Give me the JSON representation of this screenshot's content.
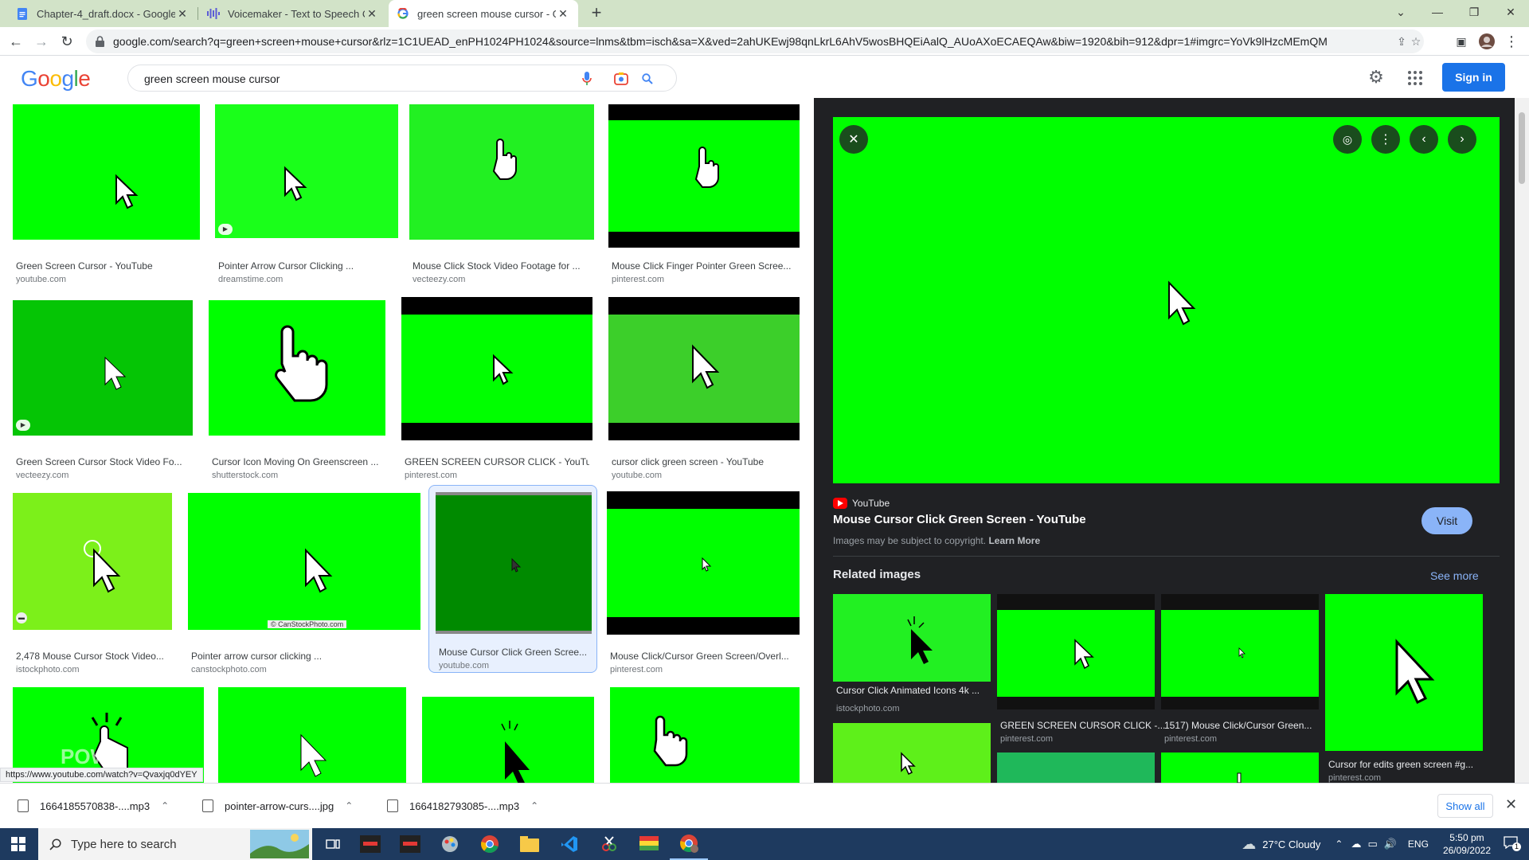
{
  "browser": {
    "tabs": [
      {
        "title": "Chapter-4_draft.docx - Google D",
        "icon": "google-docs-icon",
        "active": false
      },
      {
        "title": "Voicemaker - Text to Speech Con",
        "icon": "voicemaker-icon",
        "active": false
      },
      {
        "title": "green screen mouse cursor - Goo",
        "icon": "google-g-icon",
        "active": true
      }
    ],
    "url": "google.com/search?q=green+screen+mouse+cursor&rlz=1C1UEAD_enPH1024PH1024&source=lnms&tbm=isch&sa=X&ved=2ahUKEwj98qnLkrL6AhV5wosBHQEiAalQ_AUoAXoECAEQAw&biw=1920&bih=912&dpr=1#imgrc=YoVk9lHzcMEmQM"
  },
  "google": {
    "logo": "Google",
    "query": "green screen mouse cursor",
    "sign_in": "Sign in"
  },
  "results": [
    {
      "title": "Green Screen Cursor - YouTube",
      "source": "youtube.com"
    },
    {
      "title": "Pointer Arrow Cursor Clicking ...",
      "source": "dreamstime.com"
    },
    {
      "title": "Mouse Click Stock Video Footage for ...",
      "source": "vecteezy.com"
    },
    {
      "title": "Mouse Click Finger Pointer Green Scree...",
      "source": "pinterest.com"
    },
    {
      "title": "Green Screen Cursor Stock Video Fo...",
      "source": "vecteezy.com"
    },
    {
      "title": "Cursor Icon Moving On Greenscreen ...",
      "source": "shutterstock.com"
    },
    {
      "title": "GREEN SCREEN CURSOR CLICK - YouTu...",
      "source": "pinterest.com"
    },
    {
      "title": "cursor click green screen - YouTube",
      "source": "youtube.com"
    },
    {
      "title": "2,478 Mouse Cursor Stock Video...",
      "source": "istockphoto.com"
    },
    {
      "title": "Pointer arrow cursor clicking ...",
      "source": "canstockphoto.com",
      "watermark": "© CanStockPhoto.com"
    },
    {
      "title": "Mouse Cursor Click Green Scree...",
      "source": "youtube.com"
    },
    {
      "title": "Mouse Click/Cursor Green Screen/Overl...",
      "source": "pinterest.com"
    },
    {
      "title": "",
      "source": "",
      "watermark": "POWS"
    },
    {
      "title": "",
      "source": ""
    },
    {
      "title": "",
      "source": ""
    },
    {
      "title": "",
      "source": ""
    }
  ],
  "preview": {
    "source_name": "YouTube",
    "title": "Mouse Cursor Click Green Screen - YouTube",
    "copyright": "Images may be subject to copyright.",
    "learn_more": "Learn More",
    "visit": "Visit",
    "related_label": "Related images",
    "see_more": "See more",
    "related": [
      {
        "title": "Cursor Click Animated Icons 4k ...",
        "source": "istockphoto.com"
      },
      {
        "title": "GREEN SCREEN CURSOR CLICK -...",
        "source": "pinterest.com"
      },
      {
        "title": "1517) Mouse Click/Cursor Green...",
        "source": "pinterest.com"
      },
      {
        "title": "Cursor for edits green screen #g...",
        "source": "pinterest.com"
      },
      {
        "title": "",
        "source": ""
      },
      {
        "title": "",
        "source": ""
      },
      {
        "title": "",
        "source": ""
      }
    ]
  },
  "status_url": "https://www.youtube.com/watch?v=Qvaxjq0dYEY",
  "downloads": {
    "items": [
      "1664185570838-....mp3",
      "pointer-arrow-curs....jpg",
      "1664182793085-....mp3"
    ],
    "show_all": "Show all"
  },
  "taskbar": {
    "search_placeholder": "Type here to search",
    "weather": "27°C  Cloudy",
    "language": "ENG",
    "time": "5:50 pm",
    "date": "26/09/2022",
    "notification_count": "1"
  },
  "colors": {
    "chroma_green": "#00ff00",
    "accent_blue": "#1a73e8",
    "tab_strip": "#d2e3c8",
    "preview_bg": "#202124"
  }
}
